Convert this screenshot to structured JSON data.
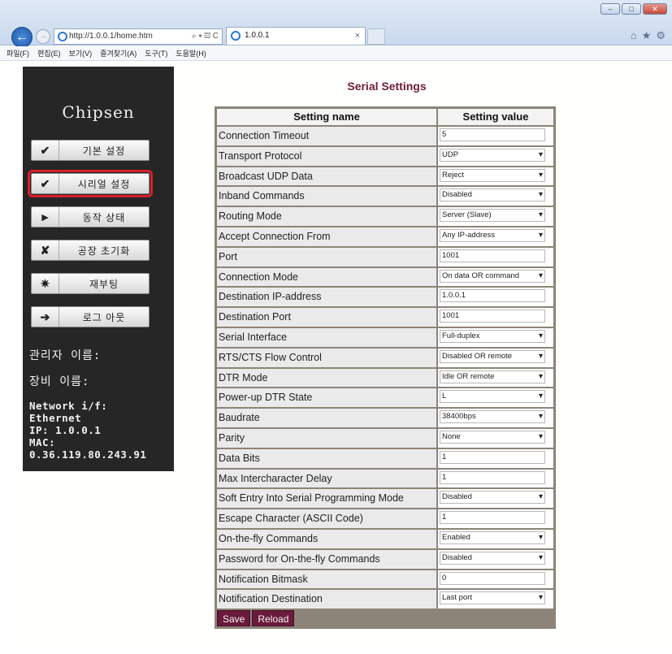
{
  "browser": {
    "url": "http://1.0.0.1/home.htm",
    "addr_controls": "⌕ ▾ ▤ C",
    "tab_title": "1.0.0.1",
    "tab_close": "×",
    "window_buttons": [
      "–",
      "□",
      "✕"
    ],
    "menu": [
      "파일(F)",
      "편집(E)",
      "보기(V)",
      "즐겨찾기(A)",
      "도구(T)",
      "도움말(H)"
    ],
    "right_icons": [
      "⌂",
      "★",
      "⚙"
    ]
  },
  "sidebar": {
    "brand": "Chipsen",
    "items": [
      {
        "icon": "✔",
        "icon_name": "check-icon",
        "label": "기본 설정"
      },
      {
        "icon": "✔",
        "icon_name": "check-icon",
        "label": "시리얼 설정",
        "active": true
      },
      {
        "icon": "►",
        "icon_name": "play-icon",
        "label": "동작 상태"
      },
      {
        "icon": "✘",
        "icon_name": "x-icon",
        "label": "공장 초기화"
      },
      {
        "icon": "✷",
        "icon_name": "burst-icon",
        "label": "재부팅"
      },
      {
        "icon": "➔",
        "icon_name": "arrow-right-icon",
        "label": "로그 아웃"
      }
    ],
    "admin_label": "관리자 이름:",
    "device_label": "장비 이름:",
    "network": [
      "Network i/f:",
      "Ethernet",
      "IP: 1.0.0.1",
      "MAC:",
      "0.36.119.80.243.91"
    ]
  },
  "main": {
    "title": "Serial Settings",
    "col_name": "Setting name",
    "col_value": "Setting value",
    "rows": [
      {
        "name": "Connection Timeout",
        "value": "5",
        "type": "text"
      },
      {
        "name": "Transport Protocol",
        "value": "UDP",
        "type": "select"
      },
      {
        "name": "Broadcast UDP Data",
        "value": "Reject",
        "type": "select"
      },
      {
        "name": "Inband Commands",
        "value": "Disabled",
        "type": "select"
      },
      {
        "name": "Routing Mode",
        "value": "Server (Slave)",
        "type": "select"
      },
      {
        "name": "Accept Connection From",
        "value": "Any IP-address",
        "type": "select"
      },
      {
        "name": "Port",
        "value": "1001",
        "type": "text"
      },
      {
        "name": "Connection Mode",
        "value": "On data OR command",
        "type": "select"
      },
      {
        "name": "Destination IP-address",
        "value": "1.0.0.1",
        "type": "text"
      },
      {
        "name": "Destination Port",
        "value": "1001",
        "type": "text"
      },
      {
        "name": "Serial Interface",
        "value": "Full-duplex",
        "type": "select"
      },
      {
        "name": "RTS/CTS Flow Control",
        "value": "Disabled OR remote",
        "type": "select"
      },
      {
        "name": "DTR Mode",
        "value": "Idle OR remote",
        "type": "select"
      },
      {
        "name": "Power-up DTR State",
        "value": "L",
        "type": "select"
      },
      {
        "name": "Baudrate",
        "value": "38400bps",
        "type": "select"
      },
      {
        "name": "Parity",
        "value": "None",
        "type": "select"
      },
      {
        "name": "Data Bits",
        "value": "1",
        "type": "text"
      },
      {
        "name": "Max Intercharacter Delay",
        "value": "1",
        "type": "text"
      },
      {
        "name": "Soft Entry Into Serial Programming Mode",
        "value": "Disabled",
        "type": "select"
      },
      {
        "name": "Escape Character (ASCII Code)",
        "value": "1",
        "type": "text"
      },
      {
        "name": "On-the-fly Commands",
        "value": "Enabled",
        "type": "select"
      },
      {
        "name": "Password for On-the-fly Commands",
        "value": "Disabled",
        "type": "select"
      },
      {
        "name": "Notification Bitmask",
        "value": "0",
        "type": "text"
      },
      {
        "name": "Notification Destination",
        "value": "Last port",
        "type": "select"
      }
    ],
    "save_label": "Save",
    "reload_label": "Reload"
  }
}
